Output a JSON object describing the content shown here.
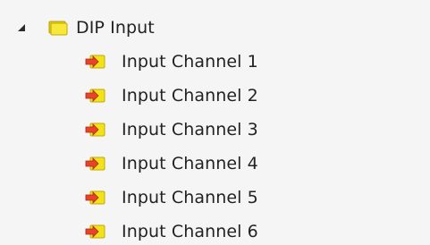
{
  "tree": {
    "parent": {
      "label": "DIP Input",
      "expander_icon": "triangle-expanded-icon",
      "icon": "folder-yellow-icon",
      "expanded": true
    },
    "children": [
      {
        "label": "Input Channel 1",
        "icon": "input-channel-icon"
      },
      {
        "label": "Input Channel 2",
        "icon": "input-channel-icon"
      },
      {
        "label": "Input Channel 3",
        "icon": "input-channel-icon"
      },
      {
        "label": "Input Channel 4",
        "icon": "input-channel-icon"
      },
      {
        "label": "Input Channel 5",
        "icon": "input-channel-icon"
      },
      {
        "label": "Input Channel 6",
        "icon": "input-channel-icon"
      }
    ]
  },
  "colors": {
    "background": "#f5f5f5",
    "text": "#222222",
    "folder_yellow": "#f2e21b",
    "arrow_red": "#e8442a"
  }
}
